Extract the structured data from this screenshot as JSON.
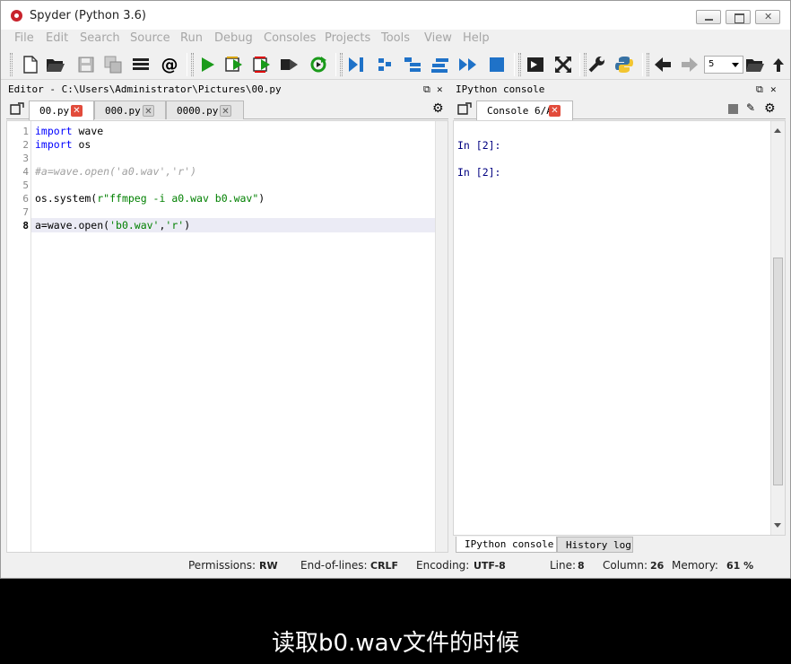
{
  "window": {
    "title": "Spyder (Python 3.6)"
  },
  "menu": [
    "File",
    "Edit",
    "Search",
    "Source",
    "Run",
    "Debug",
    "Consoles",
    "Projects",
    "Tools",
    "View",
    "Help"
  ],
  "toolbar": {
    "recent_value": "5"
  },
  "editor": {
    "title": "Editor - C:\\Users\\Administrator\\Pictures\\00.py",
    "tabs": [
      {
        "label": "00.py",
        "active": true
      },
      {
        "label": "000.py",
        "active": false
      },
      {
        "label": "0000.py",
        "active": false
      }
    ],
    "line_numbers": [
      "1",
      "2",
      "3",
      "4",
      "5",
      "6",
      "7",
      "8"
    ],
    "current_line": "8",
    "code": {
      "l1_kw": "import",
      "l1_rest": " wave",
      "l2_kw": "import",
      "l2_rest": " os",
      "l4_comment": "#a=wave.open('a0.wav','r')",
      "l6_pre": "os.system(",
      "l6_str": "r\"ffmpeg -i a0.wav b0.wav\"",
      "l6_post": ")",
      "l8_pre": "a=wave.open(",
      "l8_s1": "'b0.wav'",
      "l8_mid": ",",
      "l8_s2": "'r'",
      "l8_post": ")"
    }
  },
  "console": {
    "title": "IPython console",
    "tab_label": "Console 6/A",
    "prompts": [
      "In [2]:",
      "In [2]:"
    ],
    "bottom_tabs": [
      "IPython console",
      "History log"
    ]
  },
  "status": {
    "permissions_label": "Permissions:",
    "permissions": "RW",
    "eol_label": "End-of-lines:",
    "eol": "CRLF",
    "encoding_label": "Encoding:",
    "encoding": "UTF-8",
    "line_label": "Line:",
    "line": "8",
    "column_label": "Column:",
    "column": "26",
    "memory_label": "Memory:",
    "memory": "61 %"
  },
  "subtitle": "读取b0.wav文件的时候",
  "colors": {
    "keyword": "#0000ff",
    "string": "#008000",
    "comment": "#a0a0a0",
    "run_green": "#1a9a1a",
    "close_red": "#e24b3b",
    "accent_blue": "#1f72c8"
  }
}
